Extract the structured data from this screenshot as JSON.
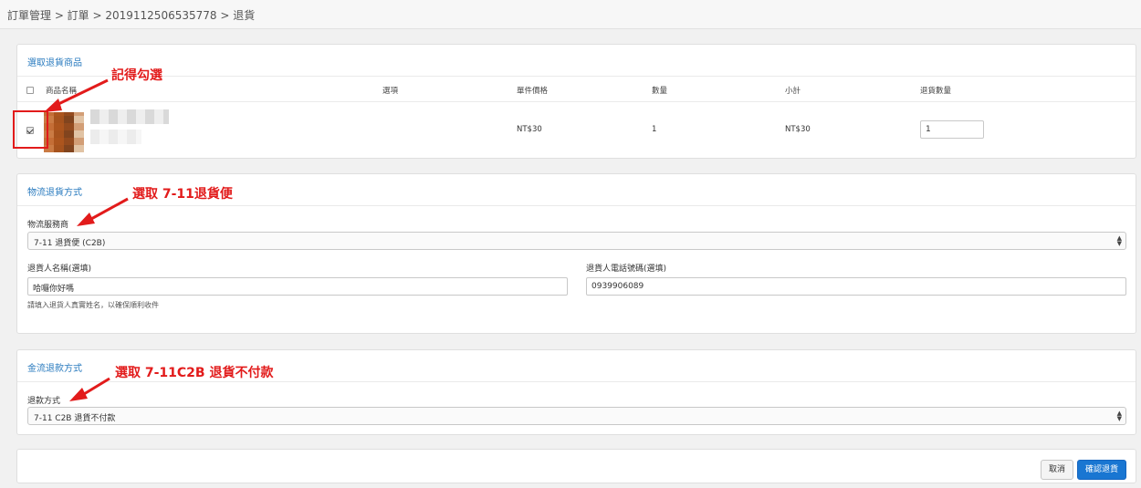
{
  "breadcrumb": {
    "text": "訂單管理 > 訂單 > 2019112506535778 > 退貨"
  },
  "products_panel": {
    "title": "選取退貨商品",
    "headers": {
      "name": "商品名稱",
      "options": "選項",
      "unit_price": "單件價格",
      "quantity": "數量",
      "subtotal": "小計",
      "return_qty": "退貨數量"
    },
    "row": {
      "checked": true,
      "unit_price": "NT$30",
      "quantity": "1",
      "subtotal": "NT$30",
      "return_qty": "1"
    }
  },
  "logistics_panel": {
    "title": "物流退貨方式",
    "provider_label": "物流服務商",
    "provider_value": "7-11 退貨便 (C2B)",
    "name_label": "退貨人名稱(選填)",
    "name_value": "哈囉你好嗎",
    "name_help": "請填入退貨人真實姓名，以確保順利收件",
    "phone_label": "退貨人電話號碼(選填)",
    "phone_value": "0939906089"
  },
  "refund_panel": {
    "title": "金流退款方式",
    "method_label": "退款方式",
    "method_value": "7-11 C2B 退貨不付款"
  },
  "actions": {
    "cancel": "取消",
    "confirm": "確認退貨"
  },
  "annotations": {
    "a1": "記得勾選",
    "a2": "選取 7-11退貨便",
    "a3": "選取 7-11C2B 退貨不付款"
  },
  "colors": {
    "accent": "#2a7bbf",
    "annotation": "#e21b1b",
    "primary_button": "#1976d2"
  }
}
